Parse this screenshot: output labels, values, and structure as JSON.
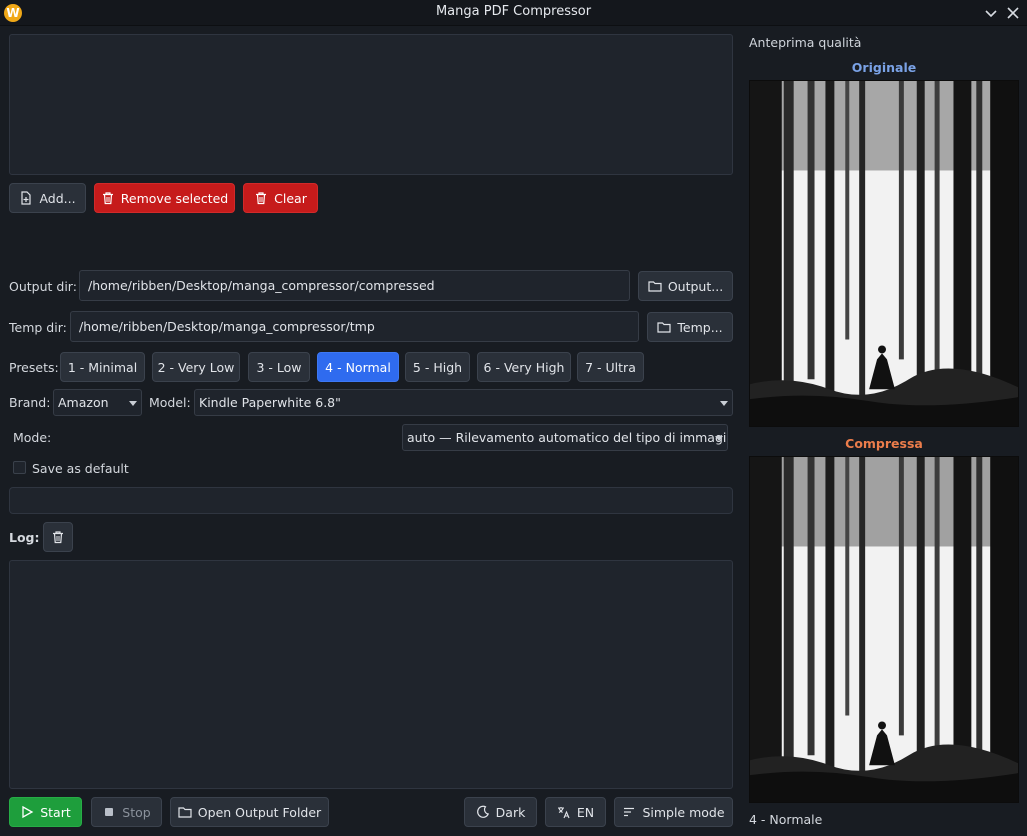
{
  "window": {
    "title": "Manga PDF Compressor",
    "logo_letter": "W"
  },
  "files": {
    "add_label": "Add...",
    "remove_label": "Remove selected",
    "clear_label": "Clear"
  },
  "output": {
    "label": "Output dir:",
    "value": "/home/ribben/Desktop/manga_compressor/compressed",
    "browse_label": "Output..."
  },
  "temp": {
    "label": "Temp dir:",
    "value": "/home/ribben/Desktop/manga_compressor/tmp",
    "browse_label": "Temp..."
  },
  "presets": {
    "label": "Presets:",
    "items": [
      "1 - Minimal",
      "2 - Very Low",
      "3 - Low",
      "4 - Normal",
      "5 - High",
      "6 - Very High",
      "7 - Ultra"
    ],
    "selected": "4 - Normal"
  },
  "device": {
    "brand_label": "Brand:",
    "brand_value": "Amazon",
    "model_label": "Model:",
    "model_value": "Kindle Paperwhite 6.8\""
  },
  "mode": {
    "label": "Mode:",
    "value": "auto — Rilevamento automatico del tipo di immagine"
  },
  "save_default": {
    "label": "Save as default",
    "checked": false
  },
  "log": {
    "label": "Log:"
  },
  "controls": {
    "start_label": "Start",
    "stop_label": "Stop",
    "open_folder_label": "Open Output Folder",
    "theme_label": "Dark",
    "lang_label": "EN",
    "simple_mode_label": "Simple mode"
  },
  "preview": {
    "title": "Anteprima qualità",
    "original_label": "Originale",
    "compressed_label": "Compressa",
    "status": "4 - Normale"
  },
  "colors": {
    "accent_blue": "#2f6bef",
    "danger_red": "#c61b1b",
    "success_green": "#1e9e3c",
    "original_label_color": "#7aa2e6",
    "compressed_label_color": "#ec7d4b"
  }
}
